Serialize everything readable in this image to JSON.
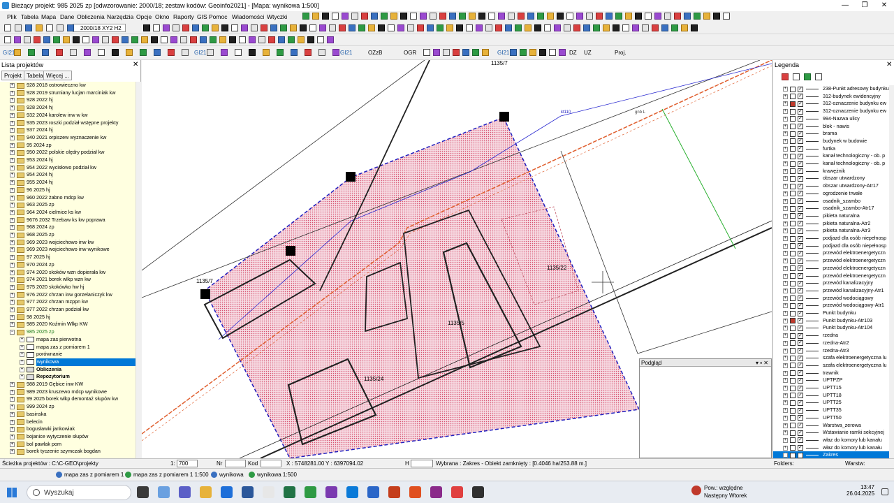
{
  "window": {
    "title": "Bieżący projekt: 985 2025 zp [odwzorowanie: 2000/18; zestaw kodów: Geoinfo2021] - [Mapa: wynikowa  1:500]",
    "controls": [
      "—",
      "❐",
      "✕"
    ]
  },
  "menu": [
    "Plik",
    "Tabela",
    "Mapa",
    "Dane",
    "Obliczenia",
    "Narzędzia",
    "Opcje",
    "Okno",
    "Raporty",
    "GIS",
    "Pomoc",
    "Wiadomości",
    "Wtyczki"
  ],
  "toolbar": {
    "coord_system": "2000/18 XY2 H2",
    "gi21_labels": [
      "GI21",
      "GI21",
      "GI21",
      "GI21"
    ],
    "ozzb": "OZzB",
    "ogr": "OGR",
    "dz": "DZ",
    "uz": "UZ",
    "proj": "Proj."
  },
  "left_panel": {
    "title": "Lista projektów",
    "close": "✕",
    "tabs": [
      "Projekt",
      "Tabela",
      "Więcej ..."
    ],
    "items": [
      {
        "label": "928 2018 ostrowieczno kw",
        "kind": "folder",
        "level": 0
      },
      {
        "label": "928 2019 strumiany lucjan marciniak kw",
        "kind": "folder",
        "level": 0
      },
      {
        "label": "928 2022 hj",
        "kind": "folder",
        "level": 0
      },
      {
        "label": "928 2024 hj",
        "kind": "folder",
        "level": 0
      },
      {
        "label": "932 2024 karolew inw w kw",
        "kind": "folder",
        "level": 0
      },
      {
        "label": "935 2023 roszki podział wstępne projekty",
        "kind": "folder",
        "level": 0
      },
      {
        "label": "937 2024 hj",
        "kind": "folder",
        "level": 0
      },
      {
        "label": "940 2021 orpiszew wyznaczenie kw",
        "kind": "folder",
        "level": 0
      },
      {
        "label": "95 2024 zp",
        "kind": "folder",
        "level": 0
      },
      {
        "label": "950 2022 polskie olędry podział kw",
        "kind": "folder",
        "level": 0
      },
      {
        "label": "953 2024 hj",
        "kind": "folder",
        "level": 0
      },
      {
        "label": "954 2022 wycisłowo podział kw",
        "kind": "folder",
        "level": 0
      },
      {
        "label": "954 2024 hj",
        "kind": "folder",
        "level": 0
      },
      {
        "label": "955 2024 hj",
        "kind": "folder",
        "level": 0
      },
      {
        "label": "96 2025 hj",
        "kind": "folder",
        "level": 0
      },
      {
        "label": "960 2022 żabno mdcp kw",
        "kind": "folder",
        "level": 0
      },
      {
        "label": "963 2025 zp",
        "kind": "folder",
        "level": 0
      },
      {
        "label": "964 2024 cielmice ks kw",
        "kind": "folder",
        "level": 0
      },
      {
        "label": "9676 2032 Trzebaw ks kw poprawa",
        "kind": "folder",
        "level": 0
      },
      {
        "label": "968 2024 zp",
        "kind": "folder",
        "level": 0
      },
      {
        "label": "968 2025 zp",
        "kind": "folder",
        "level": 0
      },
      {
        "label": "969 2023 wojciechowo inw kw",
        "kind": "folder",
        "level": 0
      },
      {
        "label": "969 2023 wojciechowo inw wynikowe",
        "kind": "folder",
        "level": 0
      },
      {
        "label": "97 2025 hj",
        "kind": "folder",
        "level": 0
      },
      {
        "label": "970 2024 zp",
        "kind": "folder",
        "level": 0
      },
      {
        "label": "974 2020 skoków wzn dopierała kw",
        "kind": "folder",
        "level": 0
      },
      {
        "label": "974 2021 borek wlkp wzn kw",
        "kind": "folder",
        "level": 0
      },
      {
        "label": "975 2020 skokówko hw hj",
        "kind": "folder",
        "level": 0
      },
      {
        "label": "976 2022 chrzan inw gorzelaniczyk kw",
        "kind": "folder",
        "level": 0
      },
      {
        "label": "977 2022 chrzan mzppn kw",
        "kind": "folder",
        "level": 0
      },
      {
        "label": "977 2022 chrzan podział kw",
        "kind": "folder",
        "level": 0
      },
      {
        "label": "98 2025 hj",
        "kind": "folder",
        "level": 0
      },
      {
        "label": "985 2020 Koźmin Wlkp KW",
        "kind": "folder",
        "level": 0
      },
      {
        "label": "985 2025 zp",
        "kind": "folder-open",
        "level": 0,
        "open": true
      },
      {
        "label": "mapa zas pierwotna",
        "kind": "map",
        "level": 1
      },
      {
        "label": "mapa zas z pomiarem 1",
        "kind": "map",
        "level": 1
      },
      {
        "label": "porównanie",
        "kind": "map",
        "level": 1
      },
      {
        "label": "wynikowa",
        "kind": "map",
        "level": 1,
        "selected": true
      },
      {
        "label": "Obliczenia",
        "kind": "calc",
        "level": 1,
        "bold": true
      },
      {
        "label": "Repozytorium",
        "kind": "calc",
        "level": 1,
        "bold": true
      },
      {
        "label": "988 2019 Gębice inw KW",
        "kind": "folder",
        "level": 0
      },
      {
        "label": "989 2023 kruszewo mdcp wynikowe",
        "kind": "folder",
        "level": 0
      },
      {
        "label": "99 2025 borek wlkp demontaż słupów kw",
        "kind": "folder",
        "level": 0
      },
      {
        "label": "999 2024 zp",
        "kind": "folder",
        "level": 0
      },
      {
        "label": "basinska",
        "kind": "folder",
        "level": 0
      },
      {
        "label": "belecin",
        "kind": "folder",
        "level": 0
      },
      {
        "label": "bogusławki jankowiak",
        "kind": "folder",
        "level": 0
      },
      {
        "label": "bojanice wytyczenie słupów",
        "kind": "folder",
        "level": 0
      },
      {
        "label": "bol pawlak pom",
        "kind": "folder",
        "level": 0
      },
      {
        "label": "borek tyczenie szymczak bogdan",
        "kind": "folder",
        "level": 0
      }
    ]
  },
  "map": {
    "labels": {
      "parcel_top": "1135/7",
      "parcel_left": "1135/7",
      "parcel_mid": "1135/22",
      "parcel_bottom": "1135/24",
      "parcel_small": "1135/5",
      "sewer_top": "kt110",
      "gas_label": "gnb L"
    }
  },
  "legend": {
    "title": "Legenda",
    "close": "✕",
    "items": [
      {
        "label": "238-Punkt adresowy budynku",
        "red": false
      },
      {
        "label": "312-budynek ewidencyjny",
        "red": false
      },
      {
        "label": "312-oznaczenie budynku ew",
        "red": true
      },
      {
        "label": "312-oznaczenie budynku ew",
        "red": false
      },
      {
        "label": "994-Nazwa ulicy",
        "red": false
      },
      {
        "label": "blok - nawis",
        "red": false
      },
      {
        "label": "brama",
        "red": false
      },
      {
        "label": "budynek w budowie",
        "red": false
      },
      {
        "label": "furtka",
        "red": false
      },
      {
        "label": "kanał technologiczny - ob. p",
        "red": false
      },
      {
        "label": "kanał technologiczny - ob. p",
        "red": false
      },
      {
        "label": "krawężnik",
        "red": false
      },
      {
        "label": "obszar utwardzony",
        "red": false
      },
      {
        "label": "obszar utwardzony-Atr17",
        "red": false
      },
      {
        "label": "ogrodzenie trwałe",
        "red": false
      },
      {
        "label": "osadnik_szambo",
        "red": false
      },
      {
        "label": "osadnik_szambo-Atr17",
        "red": false
      },
      {
        "label": "pikieta naturalna",
        "red": false
      },
      {
        "label": "pikieta naturalna-Atr2",
        "red": false
      },
      {
        "label": "pikieta naturalna-Atr3",
        "red": false
      },
      {
        "label": "podjazd dla osób niepełnosp",
        "red": false
      },
      {
        "label": "podjazd dla osób niepełnosp",
        "red": false
      },
      {
        "label": "przewód elektroenergetyczn",
        "red": false
      },
      {
        "label": "przewód elektroenergetyczn",
        "red": false
      },
      {
        "label": "przewód elektroenergetyczn",
        "red": false
      },
      {
        "label": "przewód elektroenergetyczn",
        "red": false
      },
      {
        "label": "przewód kanalizacyjny",
        "red": false
      },
      {
        "label": "przewód kanalizacyjny-Atr1",
        "red": false
      },
      {
        "label": "przewód wodociągowy",
        "red": false
      },
      {
        "label": "przewód wodociągowy-Atr1",
        "red": false
      },
      {
        "label": "Punkt budynku",
        "red": false
      },
      {
        "label": "Punkt budynku-Atr103",
        "red": true
      },
      {
        "label": "Punkt budynku-Atr104",
        "red": false
      },
      {
        "label": "rzedna",
        "red": false
      },
      {
        "label": "rzedna-Atr2",
        "red": false
      },
      {
        "label": "rzedna-Atr3",
        "red": false
      },
      {
        "label": "szafa elektroenergetyczna lu",
        "red": false
      },
      {
        "label": "szafa elektroenergetyczna lu",
        "red": false
      },
      {
        "label": "trawnik",
        "red": false
      },
      {
        "label": "UPTPZP",
        "red": false
      },
      {
        "label": "UPTT15",
        "red": false
      },
      {
        "label": "UPTT18",
        "red": false
      },
      {
        "label": "UPTT25",
        "red": false
      },
      {
        "label": "UPTT35",
        "red": false
      },
      {
        "label": "UPTT50",
        "red": false
      },
      {
        "label": "Warstwa_zerowa",
        "red": false
      },
      {
        "label": "Wstawianie ramki sekcyjnej",
        "red": false
      },
      {
        "label": "właz do komory lub kanału",
        "red": false
      },
      {
        "label": "właz do komory lub kanału",
        "red": false
      },
      {
        "label": "Zakres",
        "red": false,
        "selected": true
      }
    ]
  },
  "podglad": {
    "title": "Podgląd",
    "controls": "▾ ▪ ✕"
  },
  "status": {
    "path_label": "Ścieżka projektów : C:\\C-GEO\\projekty",
    "scale_prefix": "1:",
    "scale": "700",
    "nr_label": "Nr",
    "kod_label": "Kod",
    "x_coord": "X : 5748281.00",
    "y_coord": "Y : 6397094.02",
    "h_label": "H",
    "selected_info": "Wybrana : Zakres -  Obiekt zamknięty : [0.4046 ha/253.88 m.]",
    "folders_label": "Folders:",
    "layer_label": "Warstw:"
  },
  "doc_tabs": [
    "mapa zas z pomiarem 1",
    "mapa zas z pomiarem 1  1:500",
    "wynikowa",
    "wynikowa  1:500"
  ],
  "taskbar": {
    "search_placeholder": "Wyszukaj",
    "notification_title": "Pow.: względne",
    "notification_sub": "Następny Wtorek",
    "time": "13:47",
    "date": "26.04.2025"
  },
  "colors": {
    "parcel_fill": "#e8a8b8",
    "parcel_boundary": "#2020c0",
    "gas_line": "#e06030",
    "selection": "#0078d7",
    "tree_bg": "#ffffe0"
  }
}
